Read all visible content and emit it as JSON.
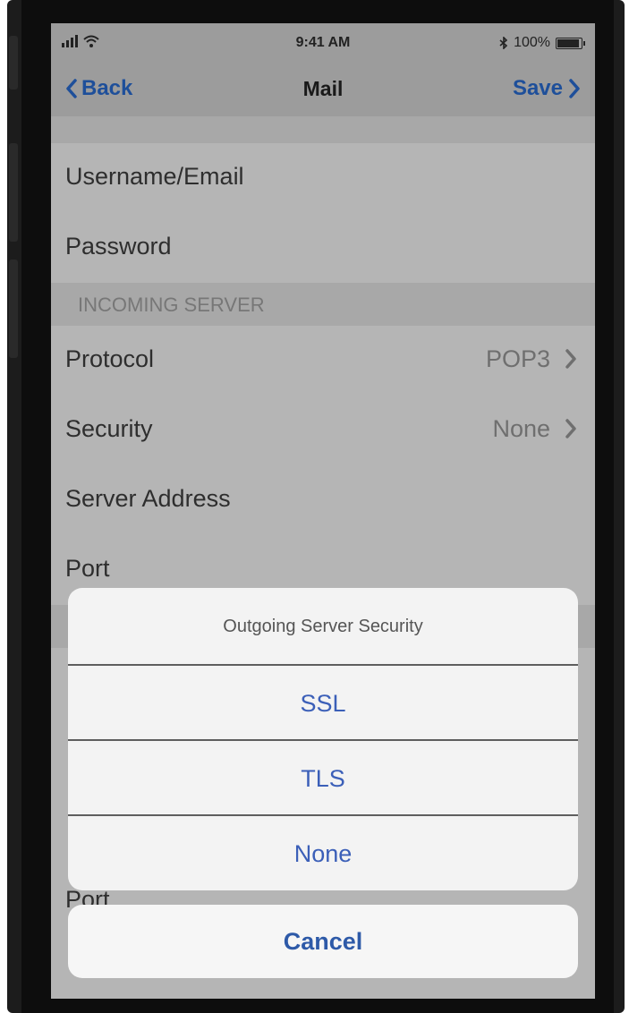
{
  "status_bar": {
    "time": "9:41 AM",
    "battery_text": "100%"
  },
  "nav": {
    "back_label": "Back",
    "title": "Mail",
    "save_label": "Save"
  },
  "fields": {
    "username_label": "Username/Email",
    "password_label": "Password"
  },
  "incoming_section": {
    "header": "INCOMING SERVER"
  },
  "incoming": {
    "protocol_label": "Protocol",
    "protocol_value": "POP3",
    "security_label": "Security",
    "security_value": "None",
    "server_address_label": "Server Address",
    "port_label": "Port"
  },
  "background_partial": {
    "port_label": "Port"
  },
  "action_sheet": {
    "title": "Outgoing Server Security",
    "options": [
      "SSL",
      "TLS",
      "None"
    ],
    "cancel_label": "Cancel"
  },
  "colors": {
    "link_blue": "#1e4f9a",
    "option_blue": "#3b5fb8"
  }
}
